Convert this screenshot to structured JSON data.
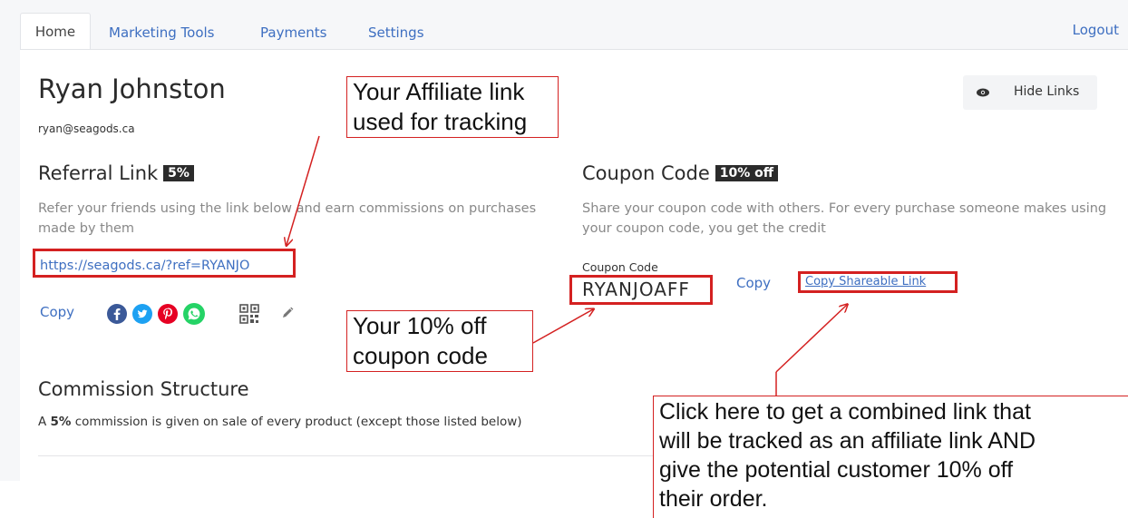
{
  "nav": {
    "tabs": [
      "Home",
      "Marketing Tools",
      "Payments",
      "Settings"
    ],
    "active_tab": "Home",
    "logout": "Logout"
  },
  "profile": {
    "name": "Ryan Johnston",
    "email": "ryan@seagods.ca"
  },
  "hide_links": {
    "icon": "eye-icon",
    "label": "Hide Links"
  },
  "referral": {
    "title": "Referral Link",
    "badge": "5%",
    "description": "Refer your friends using the link below and earn commissions on purchases made by them",
    "link": "https://seagods.ca/?ref=RYANJO",
    "copy_label": "Copy",
    "share_icons": [
      "facebook-icon",
      "twitter-icon",
      "pinterest-icon",
      "whatsapp-icon",
      "qr-code-icon",
      "edit-pencil-icon"
    ]
  },
  "coupon": {
    "title": "Coupon Code",
    "badge": "10% off",
    "description": "Share your coupon code with others. For every purchase someone makes using your coupon code, you get the credit",
    "field_label": "Coupon Code",
    "code": "RYANJOAFF",
    "copy_label": "Copy",
    "shareable_link_label": "Copy Shareable Link"
  },
  "commission": {
    "title": "Commission Structure",
    "prefix": "A ",
    "rate": "5%",
    "suffix": " commission is given on sale of every product (except those listed below)"
  },
  "annotations": {
    "affiliate_line1": "Your Affiliate link",
    "affiliate_line2": "used for tracking",
    "coupon_line1": "Your 10% off",
    "coupon_line2": "coupon code",
    "combined_line1": "Click here to get a combined link that",
    "combined_line2": "will be tracked as an affiliate link AND",
    "combined_line3": "give the potential customer 10% off",
    "combined_line4": "their order."
  },
  "colors": {
    "link_blue": "#3e6fc1",
    "annotation_red": "#d42121",
    "badge_dark": "#2b2b2b",
    "facebook": "#3b5998",
    "twitter": "#1da1f2",
    "pinterest": "#e60023",
    "whatsapp": "#25d366"
  }
}
